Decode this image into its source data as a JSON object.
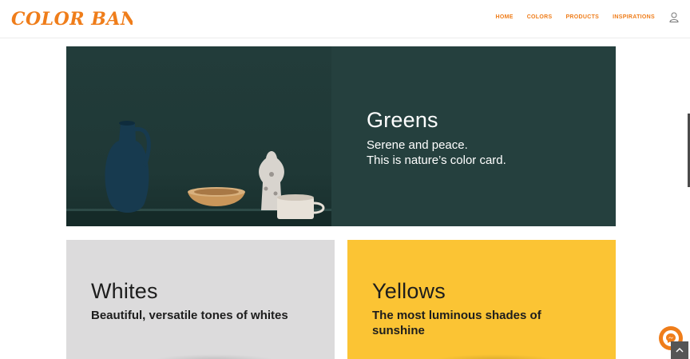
{
  "brand": {
    "logo_text": "Color Bank",
    "accent_color": "#ef7d1a"
  },
  "nav": {
    "items": [
      {
        "label": "HOME"
      },
      {
        "label": "COLORS"
      },
      {
        "label": "PRODUCTS"
      },
      {
        "label": "INSPIRATIONS"
      }
    ],
    "user_icon": "user-icon"
  },
  "hero": {
    "title": "Greens",
    "subtitle_line1": "Serene and peace.",
    "subtitle_line2": "This is nature’s color card.",
    "background_color": "#25403e"
  },
  "cards": [
    {
      "title": "Whites",
      "subtitle": "Beautiful, versatile tones of whites",
      "background_color": "#dcdbdc"
    },
    {
      "title": "Yellows",
      "subtitle": "The most luminous shades of sunshine",
      "background_color": "#fbc434"
    }
  ],
  "widgets": {
    "chat_icon": "messenger-icon",
    "scroll_top_icon": "chevron-up-icon"
  }
}
